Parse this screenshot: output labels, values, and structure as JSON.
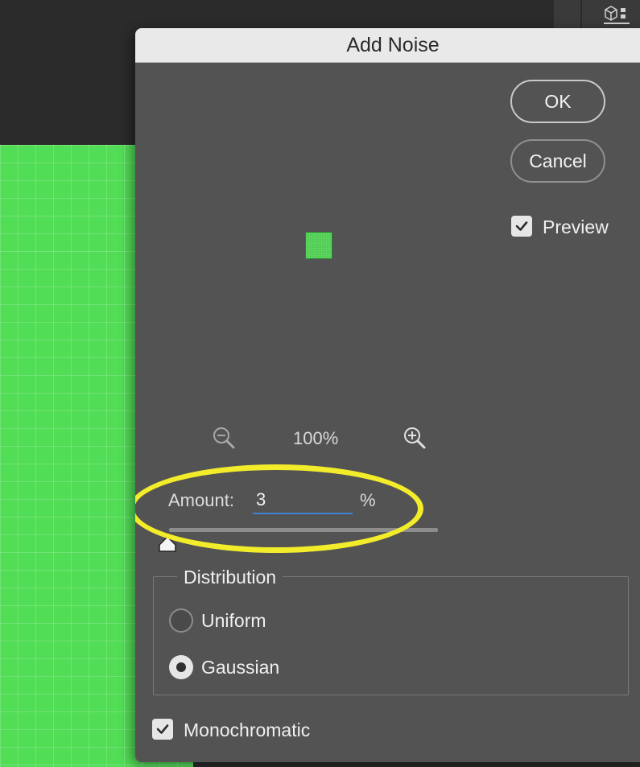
{
  "dialog": {
    "title": "Add Noise",
    "ok_label": "OK",
    "cancel_label": "Cancel",
    "preview": {
      "label": "Preview",
      "checked": true
    },
    "zoom": {
      "percent": "100%",
      "zoom_out_icon": "zoom-out-icon",
      "zoom_in_icon": "zoom-in-icon"
    },
    "amount": {
      "label": "Amount:",
      "value": "3",
      "unit": "%"
    },
    "distribution": {
      "legend": "Distribution",
      "options": [
        {
          "label": "Uniform",
          "selected": false
        },
        {
          "label": "Gaussian",
          "selected": true
        }
      ]
    },
    "monochromatic": {
      "label": "Monochromatic",
      "checked": true
    }
  },
  "colors": {
    "canvas_green": "#52dd56",
    "dialog_bg": "#535353",
    "titlebar_bg": "#e9e9e9",
    "focus_blue": "#3f84d8",
    "annotation_yellow": "#f2ec2b"
  }
}
